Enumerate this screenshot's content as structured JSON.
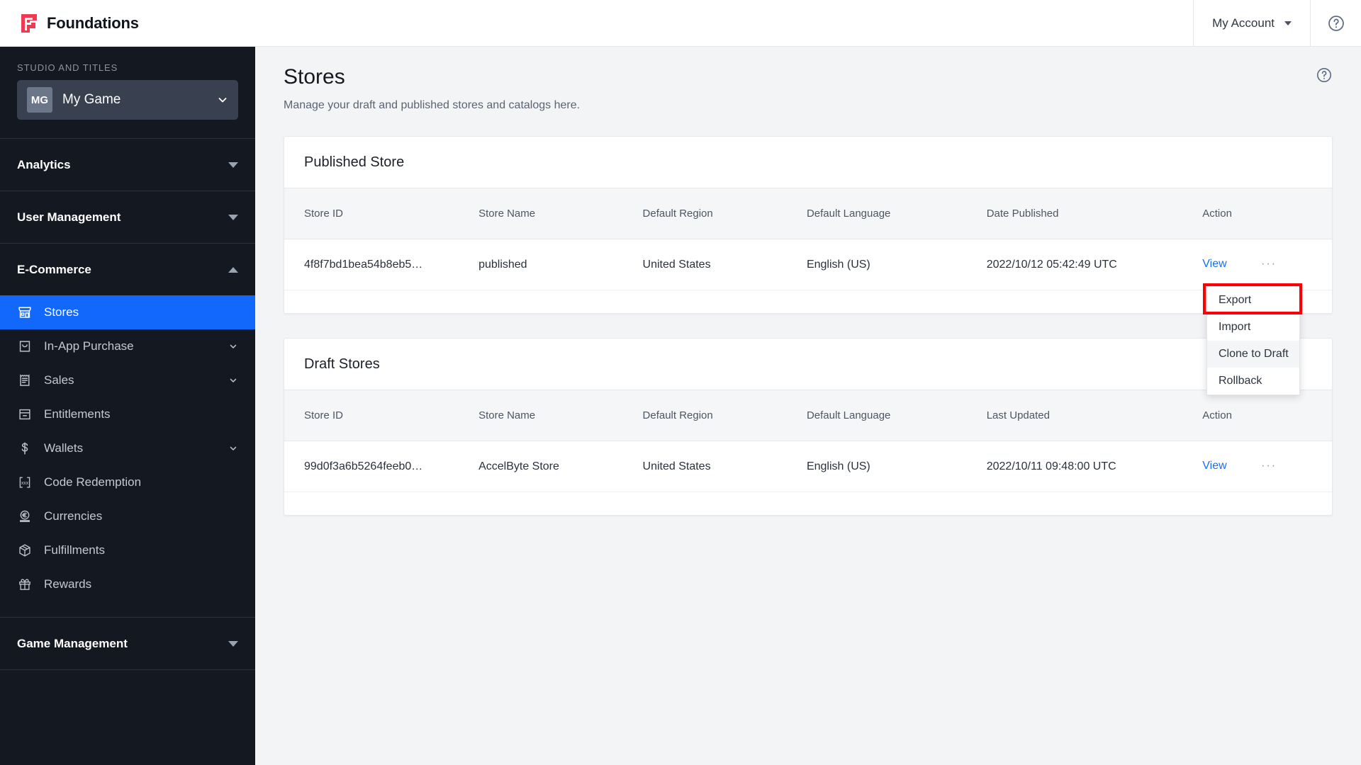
{
  "topbar": {
    "brand": "Foundations",
    "account_label": "My Account",
    "help_icon": "help-circle-icon",
    "caret_icon": "chevron-down-icon"
  },
  "sidebar": {
    "section_label": "STUDIO AND TITLES",
    "title_selector": {
      "badge": "MG",
      "name": "My Game",
      "icon": "chevron-down-icon"
    },
    "sections": [
      {
        "label": "Analytics",
        "state": "collapsed",
        "icon": "triangle-down-icon"
      },
      {
        "label": "User Management",
        "state": "collapsed",
        "icon": "triangle-down-icon"
      },
      {
        "label": "E-Commerce",
        "state": "expanded",
        "icon": "triangle-up-icon"
      }
    ],
    "ecommerce_items": [
      {
        "label": "Stores",
        "icon": "store-icon",
        "active": true,
        "expandable": false
      },
      {
        "label": "In-App Purchase",
        "icon": "bag-icon",
        "active": false,
        "expandable": true
      },
      {
        "label": "Sales",
        "icon": "receipt-icon",
        "active": false,
        "expandable": true
      },
      {
        "label": "Entitlements",
        "icon": "drawer-icon",
        "active": false,
        "expandable": false
      },
      {
        "label": "Wallets",
        "icon": "dollar-icon",
        "active": false,
        "expandable": true
      },
      {
        "label": "Code Redemption",
        "icon": "code-brackets-icon",
        "active": false,
        "expandable": false
      },
      {
        "label": "Currencies",
        "icon": "coin-euro-icon",
        "active": false,
        "expandable": false
      },
      {
        "label": "Fulfillments",
        "icon": "box-icon",
        "active": false,
        "expandable": false
      },
      {
        "label": "Rewards",
        "icon": "gift-icon",
        "active": false,
        "expandable": false
      }
    ],
    "bottom_section": {
      "label": "Game Management",
      "state": "collapsed",
      "icon": "triangle-down-icon"
    }
  },
  "page": {
    "title": "Stores",
    "subtitle": "Manage your draft and published stores and catalogs here.",
    "help_icon": "help-circle-icon"
  },
  "published": {
    "card_title": "Published Store",
    "columns": [
      "Store ID",
      "Store Name",
      "Default Region",
      "Default Language",
      "Date Published",
      "Action"
    ],
    "rows": [
      {
        "store_id": "4f8f7bd1bea54b8eb5…",
        "store_name": "published",
        "default_region": "United States",
        "default_language": "English (US)",
        "date_published": "2022/10/12 05:42:49 UTC",
        "view": "View",
        "more": "···"
      }
    ]
  },
  "draft": {
    "card_title": "Draft Stores",
    "columns": [
      "Store ID",
      "Store Name",
      "Default Region",
      "Default Language",
      "Last Updated",
      "Action"
    ],
    "rows": [
      {
        "store_id": "99d0f3a6b5264feeb0…",
        "store_name": "AccelByte Store",
        "default_region": "United States",
        "default_language": "English (US)",
        "last_updated": "2022/10/11 09:48:00 UTC",
        "view": "View",
        "more": "···"
      }
    ]
  },
  "action_menu": {
    "items": [
      {
        "label": "Export",
        "highlighted": false
      },
      {
        "label": "Import",
        "highlighted": false
      },
      {
        "label": "Clone to Draft",
        "highlighted": true
      },
      {
        "label": "Rollback",
        "highlighted": false
      }
    ],
    "annotation_color": "#fb0007",
    "annotated_item": "Export"
  },
  "colors": {
    "accent_blue": "#1268fb",
    "link_blue": "#1a6ef0",
    "sidebar_bg": "#141820",
    "brand_red": "#ef3b52",
    "page_bg": "#f3f4f6"
  }
}
